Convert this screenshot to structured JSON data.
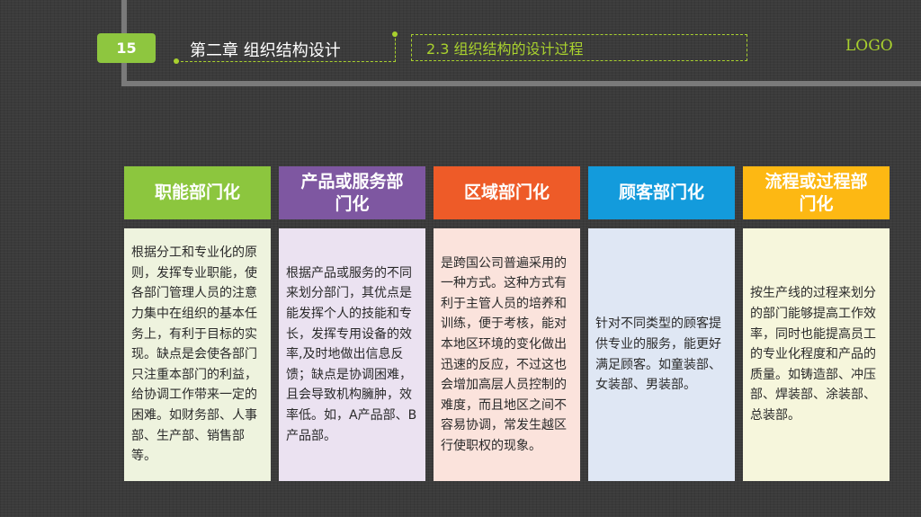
{
  "header": {
    "page_number": "15",
    "chapter_title": "第二章  组织结构设计",
    "section_title": "2.3 组织结构的设计过程",
    "logo_text": "LOGO"
  },
  "colors": {
    "accent": "#a9d12e",
    "col1": "#8cc63e",
    "col2": "#7e57a1",
    "col3": "#ee5b28",
    "col4": "#139bdc",
    "col5": "#fdb813"
  },
  "columns": [
    {
      "title": "职能部门化",
      "text": "根据分工和专业化的原则，发挥专业职能，使各部门管理人员的注意力集中在组织的基本任务上，有利于目标的实现。缺点是会使各部门只注重本部门的利益，给协调工作带来一定的困难。如财务部、人事部、生产部、销售部等。"
    },
    {
      "title": "产品或服务部门化",
      "text": "根据产品或服务的不同来划分部门，其优点是能发挥个人的技能和专长，发挥专用设备的效率,及时地做出信息反馈；缺点是协调困难，且会导致机构臃肿，效率低。如，A产品部、B产品部。"
    },
    {
      "title": "区域部门化",
      "text": "是跨国公司普遍采用的一种方式。这种方式有利于主管人员的培养和训练，便于考核，能对本地区环境的变化做出迅速的反应，不过这也会增加高层人员控制的难度，而且地区之间不容易协调，常发生越区行使职权的现象。"
    },
    {
      "title": "顾客部门化",
      "text": "针对不同类型的顾客提供专业的服务，能更好满足顾客。如童装部、女装部、男装部。"
    },
    {
      "title": "流程或过程部门化",
      "text": "按生产线的过程来划分的部门能够提高工作效率，同时也能提高员工的专业化程度和产品的质量。如铸造部、冲压部、焊装部、涂装部、总装部。"
    }
  ]
}
